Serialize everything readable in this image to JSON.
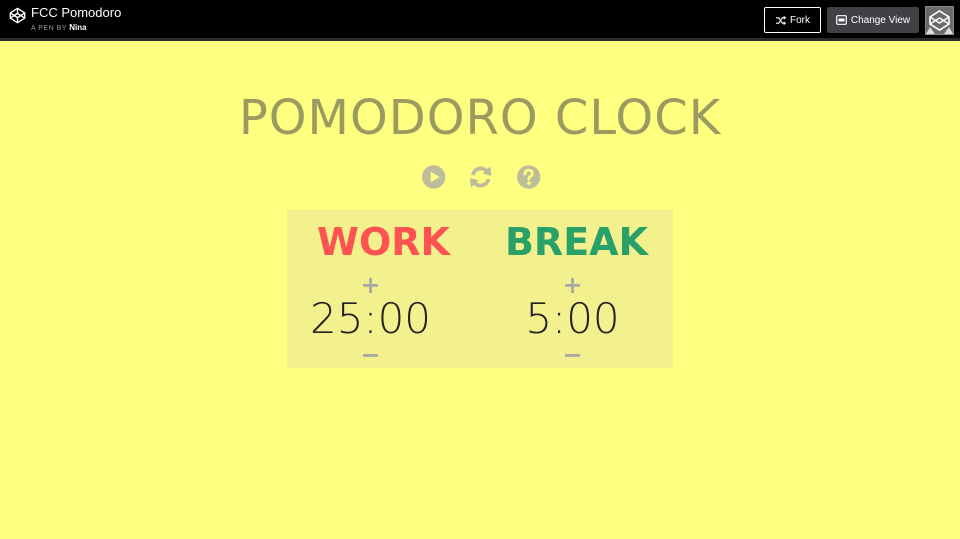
{
  "header": {
    "title": "FCC Pomodoro",
    "by_prefix": "A PEN BY",
    "author": "Nina",
    "fork_label": "Fork",
    "change_view_label": "Change View"
  },
  "app": {
    "title": "POMODORO CLOCK",
    "controls": [
      "play-icon",
      "refresh-icon",
      "help-icon"
    ],
    "work": {
      "label": "WORK",
      "plus": "+",
      "time": "25:00",
      "minus": "−"
    },
    "break": {
      "label": "BREAK",
      "plus": "+",
      "time": "5:00",
      "minus": "−"
    }
  },
  "colors": {
    "background": "#ffff80",
    "panel": "#f3f08e",
    "title": "#9b9b61",
    "work": "#ff5252",
    "break": "#28a068",
    "icon": "#bdbd9a"
  }
}
